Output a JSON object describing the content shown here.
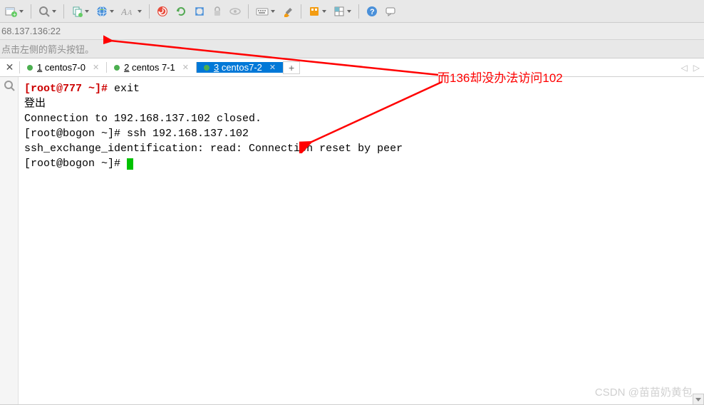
{
  "toolbar": {
    "icons": [
      "new-session",
      "search",
      "copy",
      "globe",
      "font",
      "spiral",
      "refresh",
      "expand",
      "lock",
      "eye",
      "keyboard",
      "highlight",
      "app",
      "layout",
      "help",
      "chat"
    ]
  },
  "address_bar": {
    "text": "68.137.136:22"
  },
  "hint_bar": {
    "text": "点击左侧的箭头按钮。"
  },
  "tabs": {
    "items": [
      {
        "num": "1",
        "label": "centos7-0",
        "active": false
      },
      {
        "num": "2",
        "label": "centos 7-1",
        "active": false
      },
      {
        "num": "3",
        "label": "centos7-2",
        "active": true
      }
    ]
  },
  "terminal": {
    "line1_prompt": "[root@777 ~]#",
    "line1_cmd": " exit",
    "line2": "登出",
    "line3": "Connection to 192.168.137.102 closed.",
    "line4": "[root@bogon ~]# ssh 192.168.137.102",
    "line5": "ssh_exchange_identification: read: Connection reset by peer",
    "line6": "[root@bogon ~]# "
  },
  "annotation": {
    "text": "而136却没办法访问102"
  },
  "watermark": {
    "text": "CSDN @苗苗奶黄包."
  }
}
